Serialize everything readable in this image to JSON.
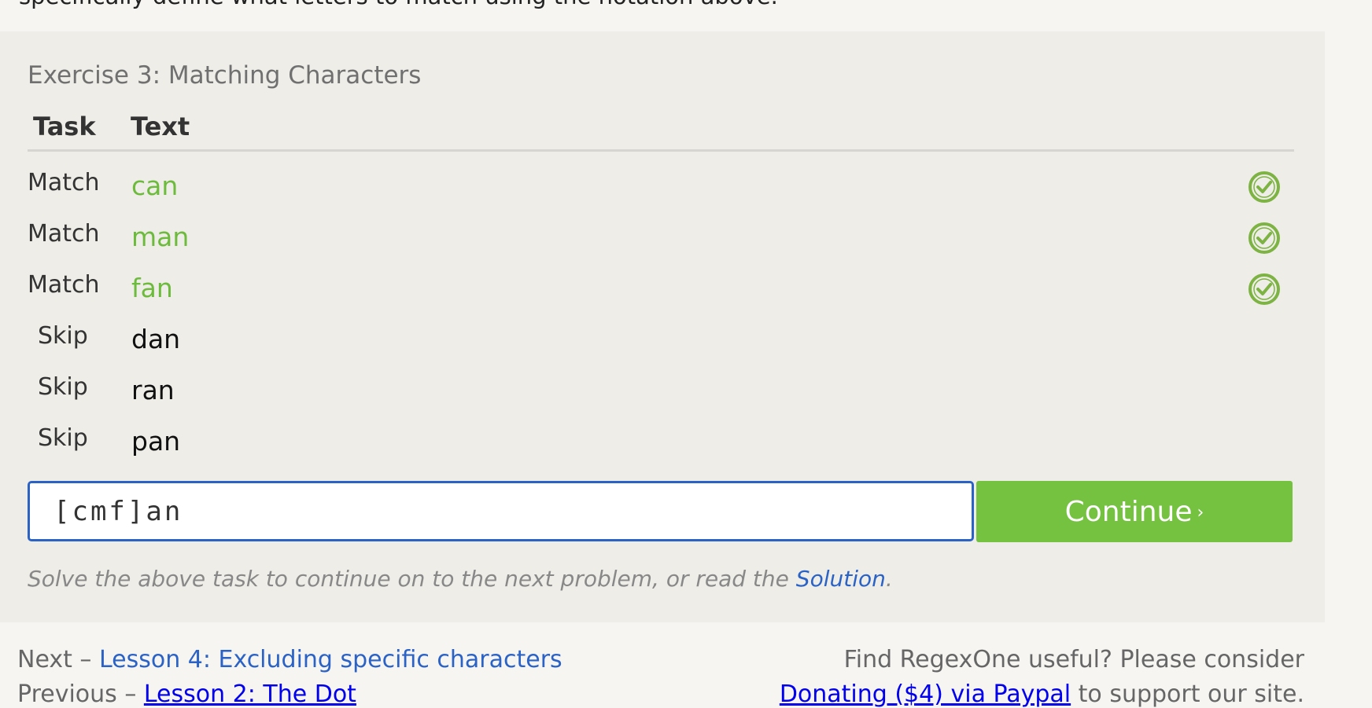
{
  "lesson": {
    "intro_tail": "specifically define what letters to match using the notation above."
  },
  "exercise": {
    "title": "Exercise 3: Matching Characters",
    "headers": {
      "task": "Task",
      "text": "Text"
    },
    "rows": [
      {
        "task": "Match",
        "text": "can",
        "status": "matched"
      },
      {
        "task": "Match",
        "text": "man",
        "status": "matched"
      },
      {
        "task": "Match",
        "text": "fan",
        "status": "matched"
      },
      {
        "task": "Skip",
        "text": "dan",
        "status": "none"
      },
      {
        "task": "Skip",
        "text": "ran",
        "status": "none"
      },
      {
        "task": "Skip",
        "text": "pan",
        "status": "none"
      }
    ],
    "input_value": "[cmf]an",
    "continue_label": "Continue",
    "continue_chevron": "›",
    "hint_prefix": "Solve the above task to continue on to the next problem, or read the ",
    "hint_link": "Solution",
    "hint_suffix": "."
  },
  "footer": {
    "next_prefix": "Next – ",
    "next_link": "Lesson 4: Excluding specific characters",
    "prev_prefix": "Previous – ",
    "prev_link": "Lesson 2: The Dot",
    "support_text": "Find RegexOne useful? Please consider",
    "donate_link": "Donating ($4) via Paypal",
    "donate_suffix": " to support our site."
  },
  "colors": {
    "matched_text": "#6dbb3d",
    "check_icon": "#7cb342",
    "continue_bg": "#75c140",
    "link": "#2a62c6"
  },
  "icons": {
    "row_status": "check-circle-icon"
  }
}
